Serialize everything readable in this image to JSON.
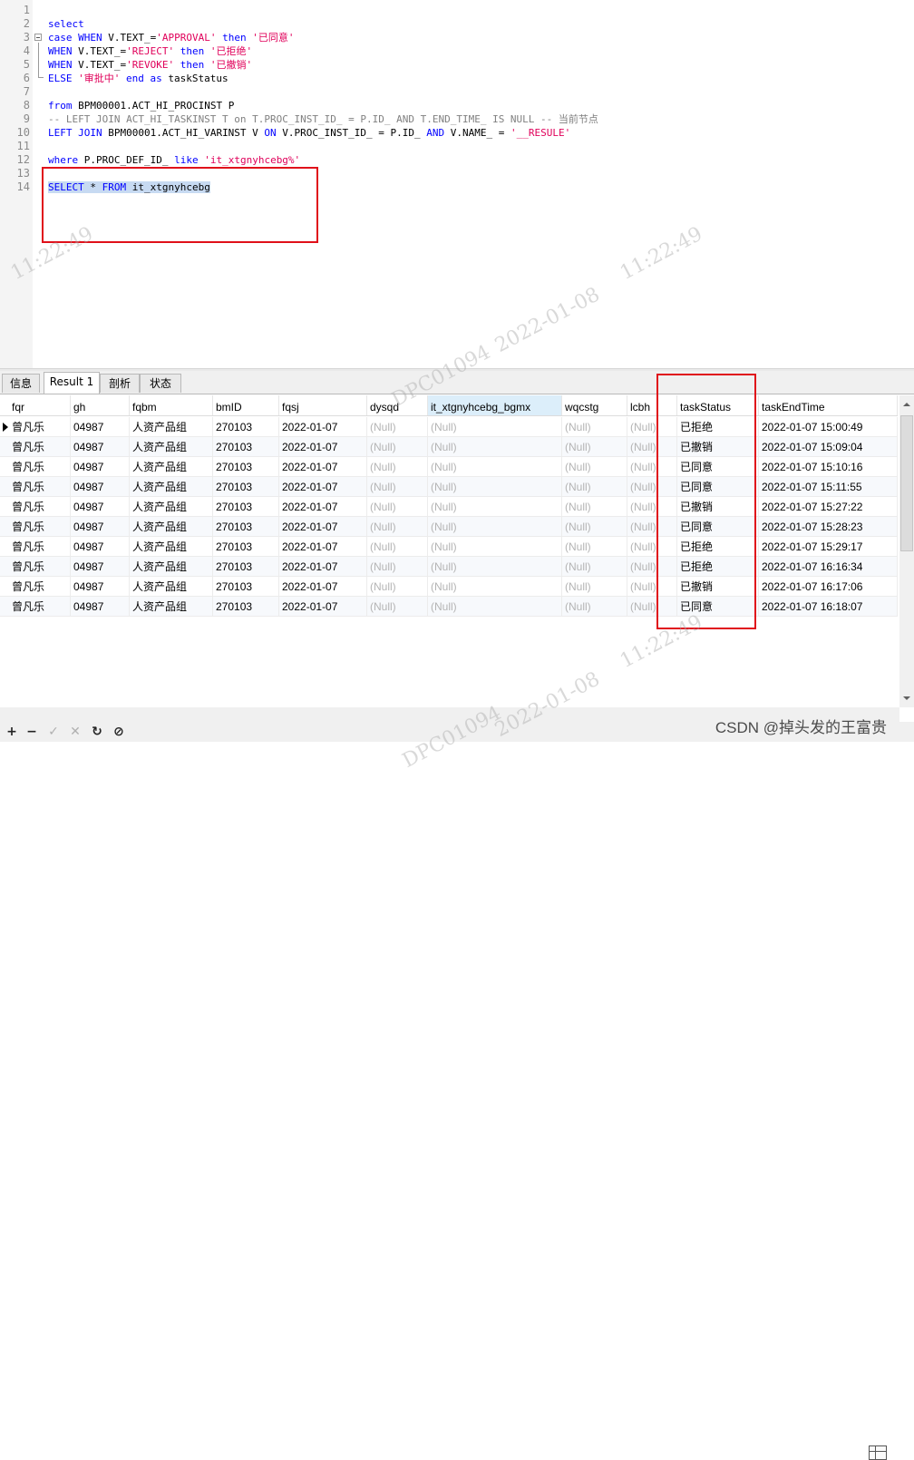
{
  "editor": {
    "lines": [
      {
        "n": "1",
        "segs": []
      },
      {
        "n": "2",
        "segs": [
          {
            "t": "select",
            "c": "kw"
          }
        ]
      },
      {
        "n": "3",
        "fold": true,
        "segs": [
          {
            "t": "case ",
            "c": "kw"
          },
          {
            "t": "WHEN ",
            "c": "kw"
          },
          {
            "t": "V.TEXT_=",
            "c": ""
          },
          {
            "t": "'APPROVAL'",
            "c": "str"
          },
          {
            "t": " then ",
            "c": "kw"
          },
          {
            "t": "'已同意'",
            "c": "str"
          }
        ]
      },
      {
        "n": "4",
        "segs": [
          {
            "t": "WHEN ",
            "c": "kw"
          },
          {
            "t": "V.TEXT_=",
            "c": ""
          },
          {
            "t": "'REJECT'",
            "c": "str"
          },
          {
            "t": " then ",
            "c": "kw"
          },
          {
            "t": "'已拒绝'",
            "c": "str"
          }
        ]
      },
      {
        "n": "5",
        "segs": [
          {
            "t": "WHEN ",
            "c": "kw"
          },
          {
            "t": "V.TEXT_=",
            "c": ""
          },
          {
            "t": "'REVOKE'",
            "c": "str"
          },
          {
            "t": " then ",
            "c": "kw"
          },
          {
            "t": "'已撤销'",
            "c": "str"
          }
        ]
      },
      {
        "n": "6",
        "segs": [
          {
            "t": "ELSE ",
            "c": "kw"
          },
          {
            "t": "'审批中'",
            "c": "str"
          },
          {
            "t": " end as ",
            "c": "kw"
          },
          {
            "t": "taskStatus",
            "c": ""
          }
        ]
      },
      {
        "n": "7",
        "segs": []
      },
      {
        "n": "8",
        "segs": [
          {
            "t": "from ",
            "c": "kw"
          },
          {
            "t": "BPM00001.ACT_HI_PROCINST P",
            "c": ""
          }
        ]
      },
      {
        "n": "9",
        "segs": [
          {
            "t": "-- LEFT JOIN ACT_HI_TASKINST T on T.PROC_INST_ID_ = P.ID_ AND T.END_TIME_ IS NULL -- 当前节点",
            "c": "cm"
          }
        ]
      },
      {
        "n": "10",
        "segs": [
          {
            "t": "LEFT JOIN ",
            "c": "kw"
          },
          {
            "t": "BPM00001.ACT_HI_VARINST V ",
            "c": ""
          },
          {
            "t": "ON ",
            "c": "kw"
          },
          {
            "t": "V.PROC_INST_ID_ = P.ID_ ",
            "c": ""
          },
          {
            "t": "AND ",
            "c": "kw"
          },
          {
            "t": "V.NAME_ = ",
            "c": ""
          },
          {
            "t": "'__RESULE'",
            "c": "str"
          }
        ]
      },
      {
        "n": "11",
        "segs": []
      },
      {
        "n": "12",
        "segs": [
          {
            "t": "where ",
            "c": "kw"
          },
          {
            "t": "P.PROC_DEF_ID_ ",
            "c": ""
          },
          {
            "t": "like ",
            "c": "kw"
          },
          {
            "t": "'it_xtgnyhcebg%'",
            "c": "str"
          }
        ]
      },
      {
        "n": "13",
        "segs": []
      },
      {
        "n": "14",
        "segs": [
          {
            "t": "SELECT",
            "c": "kw sel"
          },
          {
            "t": " * ",
            "c": "sel"
          },
          {
            "t": "FROM",
            "c": "kw sel"
          },
          {
            "t": " it_xtgnyhcebg",
            "c": "sel"
          }
        ]
      }
    ]
  },
  "tabs": [
    "信息",
    "Result 1",
    "剖析",
    "状态"
  ],
  "grid": {
    "columns": [
      "fqr",
      "gh",
      "fqbm",
      "bmID",
      "fqsj",
      "dysqd",
      "it_xtgnyhcebg_bgmx",
      "wqcstg",
      "lcbh",
      "taskStatus",
      "taskEndTime"
    ],
    "rows": [
      [
        "曾凡乐",
        "04987",
        "人资产品组",
        "270103",
        "2022-01-07",
        "(Null)",
        "(Null)",
        "(Null)",
        "(Null)",
        "已拒绝",
        "2022-01-07 15:00:49"
      ],
      [
        "曾凡乐",
        "04987",
        "人资产品组",
        "270103",
        "2022-01-07",
        "(Null)",
        "(Null)",
        "(Null)",
        "(Null)",
        "已撤销",
        "2022-01-07 15:09:04"
      ],
      [
        "曾凡乐",
        "04987",
        "人资产品组",
        "270103",
        "2022-01-07",
        "(Null)",
        "(Null)",
        "(Null)",
        "(Null)",
        "已同意",
        "2022-01-07 15:10:16"
      ],
      [
        "曾凡乐",
        "04987",
        "人资产品组",
        "270103",
        "2022-01-07",
        "(Null)",
        "(Null)",
        "(Null)",
        "(Null)",
        "已同意",
        "2022-01-07 15:11:55"
      ],
      [
        "曾凡乐",
        "04987",
        "人资产品组",
        "270103",
        "2022-01-07",
        "(Null)",
        "(Null)",
        "(Null)",
        "(Null)",
        "已撤销",
        "2022-01-07 15:27:22"
      ],
      [
        "曾凡乐",
        "04987",
        "人资产品组",
        "270103",
        "2022-01-07",
        "(Null)",
        "(Null)",
        "(Null)",
        "(Null)",
        "已同意",
        "2022-01-07 15:28:23"
      ],
      [
        "曾凡乐",
        "04987",
        "人资产品组",
        "270103",
        "2022-01-07",
        "(Null)",
        "(Null)",
        "(Null)",
        "(Null)",
        "已拒绝",
        "2022-01-07 15:29:17"
      ],
      [
        "曾凡乐",
        "04987",
        "人资产品组",
        "270103",
        "2022-01-07",
        "(Null)",
        "(Null)",
        "(Null)",
        "(Null)",
        "已拒绝",
        "2022-01-07 16:16:34"
      ],
      [
        "曾凡乐",
        "04987",
        "人资产品组",
        "270103",
        "2022-01-07",
        "(Null)",
        "(Null)",
        "(Null)",
        "(Null)",
        "已撤销",
        "2022-01-07 16:17:06"
      ],
      [
        "曾凡乐",
        "04987",
        "人资产品组",
        "270103",
        "2022-01-07",
        "(Null)",
        "(Null)",
        "(Null)",
        "(Null)",
        "已同意",
        "2022-01-07 16:18:07"
      ]
    ]
  },
  "watermarks": [
    "11:22:49",
    "11:22:49",
    "DPC01094",
    "2022-01-08",
    "11:22:49",
    "2022-01-08",
    "DPC01094"
  ],
  "footer": {
    "credit": "CSDN @掉头发的王富贵"
  },
  "colors": {
    "highlight_box": "#e0101a",
    "keyword": "#0000ff",
    "string": "#e0005a",
    "comment": "#808080",
    "selection": "#c7daf2"
  }
}
